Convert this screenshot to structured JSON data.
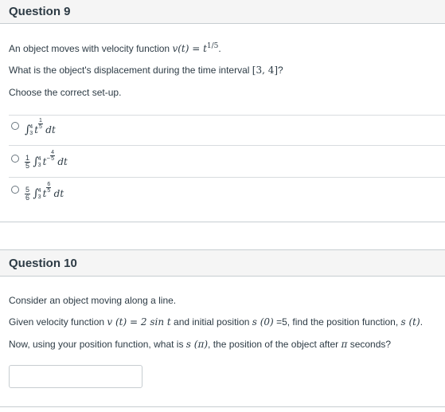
{
  "q9": {
    "title": "Question 9",
    "line1_pre": "An object moves with velocity function ",
    "line1_math": "v(t) = t",
    "line1_exp": "1/5",
    "line1_post": ".",
    "line2_pre": "What is the object's displacement during the time interval ",
    "line2_math": "[3, 4]",
    "line2_post": "?",
    "line3": "Choose the correct set-up.",
    "options": [
      {
        "upper": "4",
        "lower": "3",
        "coef_num": "",
        "coef_den": "",
        "base": "t",
        "exp_sign": "",
        "exp_num": "1",
        "exp_den": "5",
        "dt": "dt"
      },
      {
        "upper": "4",
        "lower": "3",
        "coef_num": "1",
        "coef_den": "5",
        "base": "t",
        "exp_sign": "−",
        "exp_num": "4",
        "exp_den": "5",
        "dt": "dt"
      },
      {
        "upper": "4",
        "lower": "3",
        "coef_num": "5",
        "coef_den": "6",
        "base": "t",
        "exp_sign": "",
        "exp_num": "6",
        "exp_den": "5",
        "dt": "dt"
      }
    ]
  },
  "q10": {
    "title": "Question 10",
    "line1": "Consider an object moving along a line.",
    "line2_a": "Given velocity function ",
    "line2_b": "v (t) = 2 sin t",
    "line2_c": " and initial position ",
    "line2_d": "s (0)",
    "line2_e": " =5, find the position function, ",
    "line2_f": "s (t)",
    "line2_g": ".",
    "line3_a": "Now, using your position function, what is ",
    "line3_b": "s (π)",
    "line3_c": ", the position of the object after ",
    "line3_d": "π",
    "line3_e": " seconds?",
    "answer_value": ""
  },
  "colors": {
    "text": "#2d3b45",
    "header_bg": "#f5f5f5",
    "border": "#c7cdd1"
  },
  "icons": {
    "radio": "radio-button-icon"
  }
}
